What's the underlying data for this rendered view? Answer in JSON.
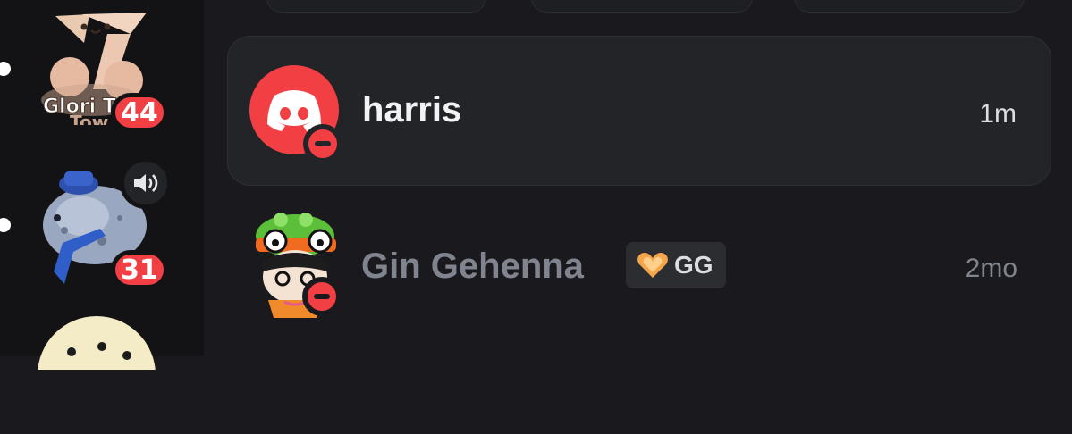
{
  "server_rail": {
    "servers": [
      {
        "name_text": "Glori Tow",
        "unread_badge": "44"
      },
      {
        "unread_badge": "31",
        "voice_icon": "speaker-icon"
      },
      {
        "partial": true
      }
    ]
  },
  "dm_list": {
    "items": [
      {
        "name": "harris",
        "time": "1m",
        "status": "dnd",
        "avatar": "discord-logo-icon",
        "active": true
      },
      {
        "name": "Gin Gehenna",
        "time": "2mo",
        "status": "dnd",
        "guild_tag": "GG",
        "guild_tag_icon": "heart-icon"
      }
    ]
  },
  "colors": {
    "accent_red": "#f23f43",
    "rail_bg": "#131316",
    "main_bg": "#1a1a1e",
    "active_row": "#232428"
  }
}
